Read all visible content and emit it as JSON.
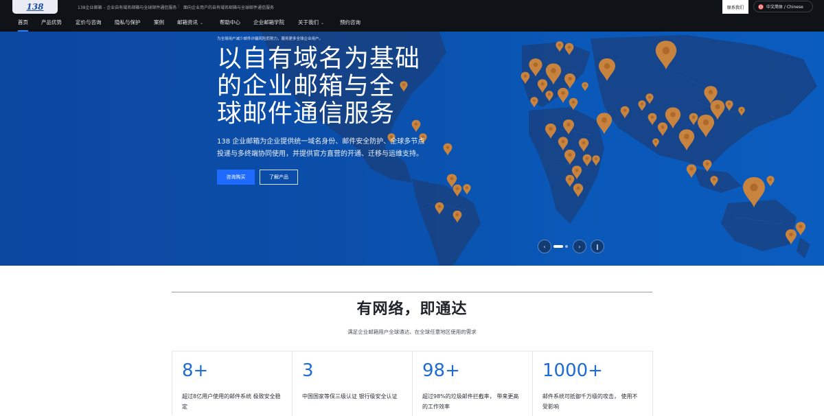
{
  "colors": {
    "accent": "#1f6bff",
    "hero_bg": "#0b4ea9",
    "pin": "#c8843f",
    "nav_bg": "#0f1216",
    "stat_number": "#1f6bd6"
  },
  "topbar": {
    "logo": "138",
    "tagline_1": "138企业邮箱 – 企业自有域名邮箱与全球邮件通信服务",
    "separator": "|",
    "tagline_2": "面向企业用户的自有域名邮箱与全球邮件通信服务",
    "contact_label": "联系我们",
    "lang_label": "中文简体 / Chinese",
    "lang_icon": "globe-icon"
  },
  "nav": {
    "items": [
      {
        "label": "首页"
      },
      {
        "label": "产品优势"
      },
      {
        "label": "定价与咨询"
      },
      {
        "label": "隐私与保护"
      },
      {
        "label": "案例"
      },
      {
        "label": "邮箱资讯"
      },
      {
        "label": "帮助中心"
      },
      {
        "label": "企业邮箱学院"
      },
      {
        "label": "关于我们"
      },
      {
        "label": "预约咨询"
      }
    ],
    "caret": "⌄"
  },
  "hero": {
    "kicker": "为全球用户减少邮件诈骗风险而努力，服务更多全球企业用户。",
    "title_lines": [
      "以自有域名为基础",
      "的企业邮箱与全",
      "球邮件通信服务"
    ],
    "desc_lines": [
      "138 企业邮箱为企业提供统一域名身份、邮件安全防护、全球多节点",
      "投递与多终端协同使用，并提供官方直营的开通、迁移与运维支持。"
    ],
    "primary_button": "咨询购买",
    "secondary_button": "了解产品",
    "prev_icon": "‹",
    "next_icon": "›",
    "pause_icon": "‖"
  },
  "section": {
    "title": "有网络，即通达",
    "subtitle": "满足企业邮箱用户全球通达、在全球任意地区使用的需求",
    "stats": [
      {
        "number": "8+",
        "desc": "超过8亿用户使用的邮件系统 极致安全稳定"
      },
      {
        "number": "3",
        "desc": "中国国家等保三级认证 银行级安全认证"
      },
      {
        "number": "98+",
        "desc": "超过98%的垃圾邮件拦截率， 带来更高的工作效率"
      },
      {
        "number": "1000+",
        "desc": "邮件系统可抵御千万级的攻击， 使用不受影响"
      }
    ]
  }
}
